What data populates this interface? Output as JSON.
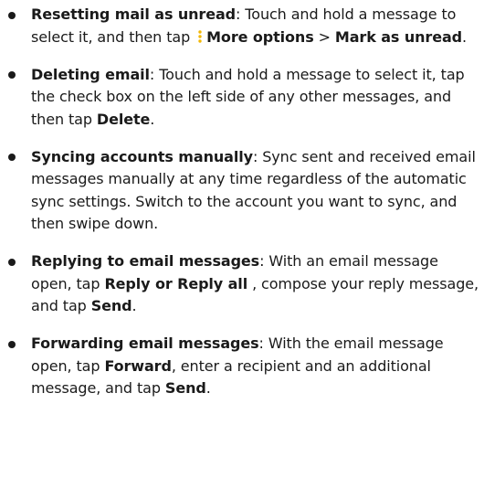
{
  "tips": [
    {
      "term": "Resetting mail as unread",
      "sep": ": ",
      "text_1": "Touch and hold a message to select it, and then tap ",
      "icon": "more-options-vertical-dots-icon",
      "icon_color": "#f2b705",
      "bold_1": "More options",
      "arrow": " > ",
      "bold_2": "Mark as unread",
      "end": "."
    },
    {
      "term": "Deleting email",
      "sep": ": ",
      "text_1": "Touch and hold a message to select it, tap the check box on the left side of any other messages, and then tap ",
      "bold_1": "Delete",
      "end": "."
    },
    {
      "term": "Syncing accounts manually",
      "sep": ": ",
      "text_1": "Sync sent and received email messages manually at any time regardless of the automatic sync settings. Switch to the account you want to sync, and then swipe down."
    },
    {
      "term": "Replying to email messages",
      "sep": ": ",
      "text_1": "With an email message open, tap ",
      "bold_1": "Reply or Reply all",
      "text_2": " , compose your reply message, and tap ",
      "bold_2": "Send",
      "end": "."
    },
    {
      "term": "Forwarding email messages",
      "sep": ": ",
      "text_1": "With the email message open, tap ",
      "bold_1": "Forward",
      "text_2": ", enter a recipient and an additional message, and tap ",
      "bold_2": "Send",
      "end": "."
    }
  ]
}
